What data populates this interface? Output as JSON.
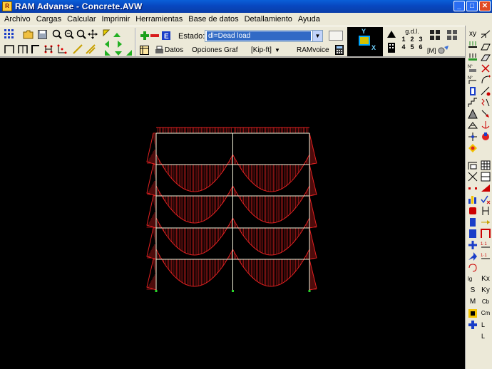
{
  "window": {
    "title": "RAM Advanse - Concrete.AVW",
    "minimize": "_",
    "maximize": "□",
    "close": "✕"
  },
  "menu": [
    "Archivo",
    "Cargas",
    "Calcular",
    "Imprimir",
    "Herramientas",
    "Base de datos",
    "Detallamiento",
    "Ayuda"
  ],
  "toolbar": {
    "estado_label": "Estado:",
    "estado_value": "dl=Dead load",
    "datos_label": "Datos",
    "opciones_label": "Opciones Graf",
    "units_label": "[Kip-ft]",
    "ramvoice_label": "RAMvoice",
    "view_y": "Y",
    "view_x": "X",
    "gdl_title": "g.d.l.",
    "gdl_row1": [
      "1",
      "2",
      "3"
    ],
    "gdl_row2": [
      "4",
      "5",
      "6"
    ],
    "brackets_label": "[M]",
    "xy_label": "xy"
  },
  "right_toolbar_labels": [
    "S",
    "M",
    "Cb",
    "Cm",
    "Kx",
    "Ky"
  ],
  "colors": {
    "canvas": "#000000",
    "frame": "#f5f5dc",
    "diagram": "#e02020",
    "titlebar": "#0a4fcc"
  },
  "frame": {
    "stories": 5,
    "bays": 2,
    "load_case": "Dead load"
  }
}
